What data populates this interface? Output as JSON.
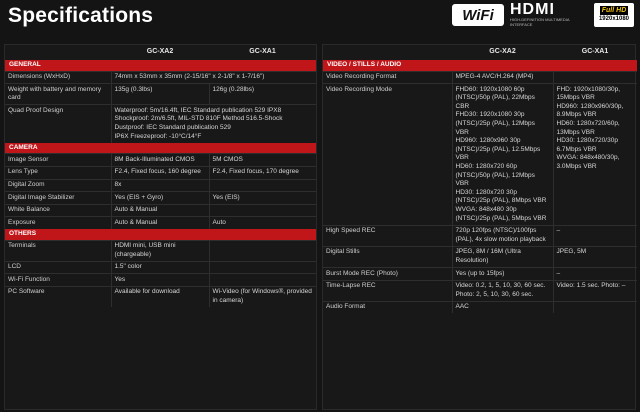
{
  "page": {
    "title": "Specifications",
    "logos": {
      "wifi": "WiFi",
      "hdmi": "HDMI",
      "hdmi_tag": "HIGH-DEFINITION MULTIMEDIA INTERFACE",
      "fullhd_top": "Full HD",
      "fullhd_bottom": "1920x1080"
    },
    "colors": {
      "accent": "#c0161a",
      "background": "#141414"
    }
  },
  "left_table": {
    "columns": [
      "",
      "GC-XA2",
      "GC-XA1"
    ],
    "sections": [
      {
        "title": "GENERAL",
        "rows": [
          {
            "label": "Dimensions (WxHxD)",
            "span": "74mm x 53mm x 35mm (2-15/16\" x 2-1/8\" x 1-7/16\")"
          },
          {
            "label": "Weight with battery and memory card",
            "a": "135g (0.3lbs)",
            "b": "126g (0.28lbs)"
          },
          {
            "label": "Quad Proof Design",
            "span": "Waterproof: 5m/16.4ft, IEC Standard publication 529 IPX8\nShockproof: 2m/6.5ft, MIL-STD 810F Method 516.5-Shock\nDustproof: IEC Standard publication 529\nIP6X Freezeproof: -10°C/14°F"
          }
        ]
      },
      {
        "title": "CAMERA",
        "rows": [
          {
            "label": "Image Sensor",
            "a": "8M Back-Illuminated CMOS",
            "b": "5M CMOS"
          },
          {
            "label": "Lens Type",
            "a": "F2.4, Fixed focus, 160 degree",
            "b": "F2.4, Fixed focus, 170 degree"
          },
          {
            "label": "Digital Zoom",
            "a": "8x",
            "b": ""
          },
          {
            "label": "Digital Image Stabilizer",
            "a": "Yes (EIS + Gyro)",
            "b": "Yes (EIS)"
          },
          {
            "label": "White Balance",
            "a": "Auto & Manual",
            "b": ""
          },
          {
            "label": "Exposure",
            "a": "Auto & Manual",
            "b": "Auto"
          }
        ]
      },
      {
        "title": "OTHERS",
        "rows": [
          {
            "label": "Terminals",
            "a": "HDMI mini, USB mini (chargeable)",
            "b": ""
          },
          {
            "label": "LCD",
            "a": "1.5\" color",
            "b": ""
          },
          {
            "label": "Wi-Fi Function",
            "a": "Yes",
            "b": ""
          },
          {
            "label": "PC Software",
            "a": "Available for download",
            "b": "Wi-Video (for Windows®, provided in camera)"
          }
        ]
      }
    ]
  },
  "right_table": {
    "columns": [
      "",
      "GC-XA2",
      "GC-XA1"
    ],
    "sections": [
      {
        "title": "VIDEO / STILLS / AUDIO",
        "rows": [
          {
            "label": "Video Recording Format",
            "a": "MPEG-4 AVC/H.264 (MP4)",
            "b": ""
          },
          {
            "label": "Video Recording Mode",
            "a": "FHD60: 1920x1080 60p (NTSC)/50p (PAL), 22Mbps CBR\nFHD30: 1920x1080 30p (NTSC)/25p (PAL), 12Mbps VBR\nHD960: 1280x960 30p (NTSC)/25p (PAL), 12.5Mbps VBR\nHD60: 1280x720 60p (NTSC)/50p (PAL), 12Mbps VBR\nHD30: 1280x720 30p (NTSC)/25p (PAL), 8Mbps VBR\nWVGA: 848x480 30p (NTSC)/25p (PAL), 5Mbps VBR",
            "b": "FHD: 1920x1080/30p, 15Mbps VBR\nHD960: 1280x960/30p, 8.9Mbps VBR\nHD60: 1280x720/60p, 13Mbps VBR\nHD30: 1280x720/30p 6.7Mbps VBR\nWVGA: 848x480/30p, 3.0Mbps VBR"
          },
          {
            "label": "High Speed REC",
            "a": "720p 120fps (NTSC)/100fps (PAL), 4x slow motion playback",
            "b": "–"
          },
          {
            "label": "Digital Stills",
            "a": "JPEG, 8M / 16M (Ultra Resolution)",
            "b": "JPEG, 5M"
          },
          {
            "label": "Burst Mode REC (Photo)",
            "a": "Yes (up to 15fps)",
            "b": "–"
          },
          {
            "label": "Time-Lapse REC",
            "a": "Video: 0.2, 1, 5, 10, 30, 60 sec.\nPhoto: 2, 5, 10, 30, 60 sec.",
            "b": "Video: 1.5 sec. Photo: –"
          },
          {
            "label": "Audio Format",
            "a": "AAC",
            "b": ""
          }
        ]
      }
    ]
  }
}
